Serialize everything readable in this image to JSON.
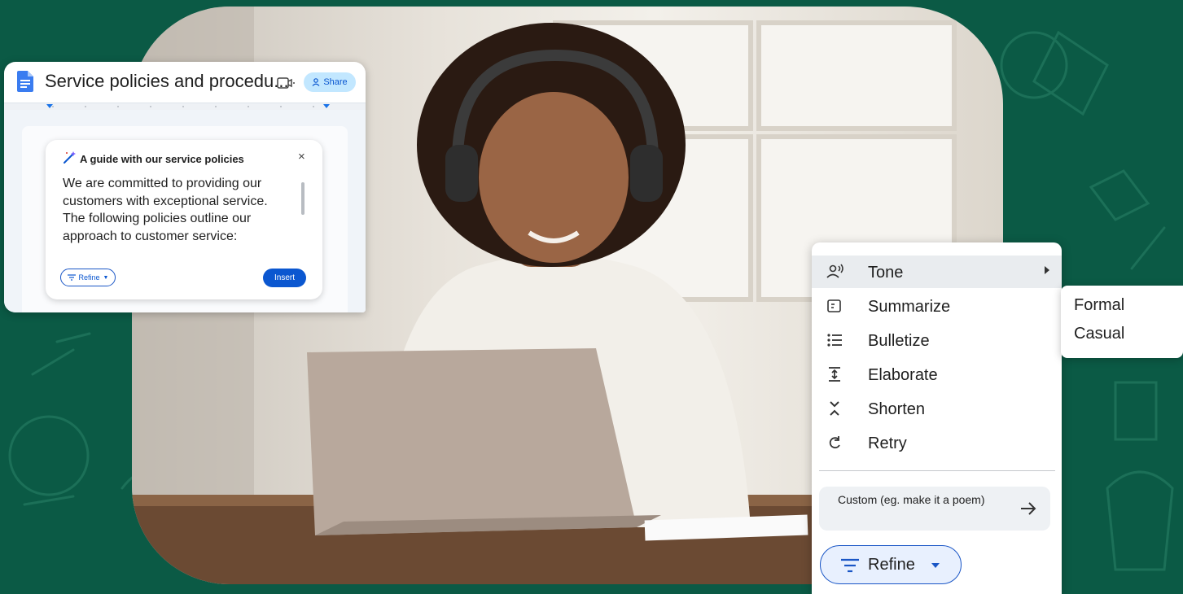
{
  "doc": {
    "title": "Service policies and procedu...",
    "share_label": "Share",
    "help_card": {
      "title": "A guide with our service policies",
      "close_label": "×",
      "body": "We are committed to providing our customers with exceptional service. The following policies outline our approach to customer service:",
      "refine_label": "Refine",
      "insert_label": "Insert"
    }
  },
  "menu": {
    "items": [
      {
        "label": "Tone",
        "icon": "tone-icon",
        "has_submenu": true
      },
      {
        "label": "Summarize",
        "icon": "summarize-icon"
      },
      {
        "label": "Bulletize",
        "icon": "bulletize-icon"
      },
      {
        "label": "Elaborate",
        "icon": "elaborate-icon"
      },
      {
        "label": "Shorten",
        "icon": "shorten-icon"
      },
      {
        "label": "Retry",
        "icon": "retry-icon"
      }
    ],
    "custom_placeholder": "Custom (eg. make it a poem)",
    "refine_label": "Refine"
  },
  "submenu": {
    "items": [
      "Formal",
      "Casual"
    ]
  },
  "colors": {
    "background": "#0b5a45",
    "accent": "#0b57d0",
    "share_bg": "#c2e7ff"
  }
}
